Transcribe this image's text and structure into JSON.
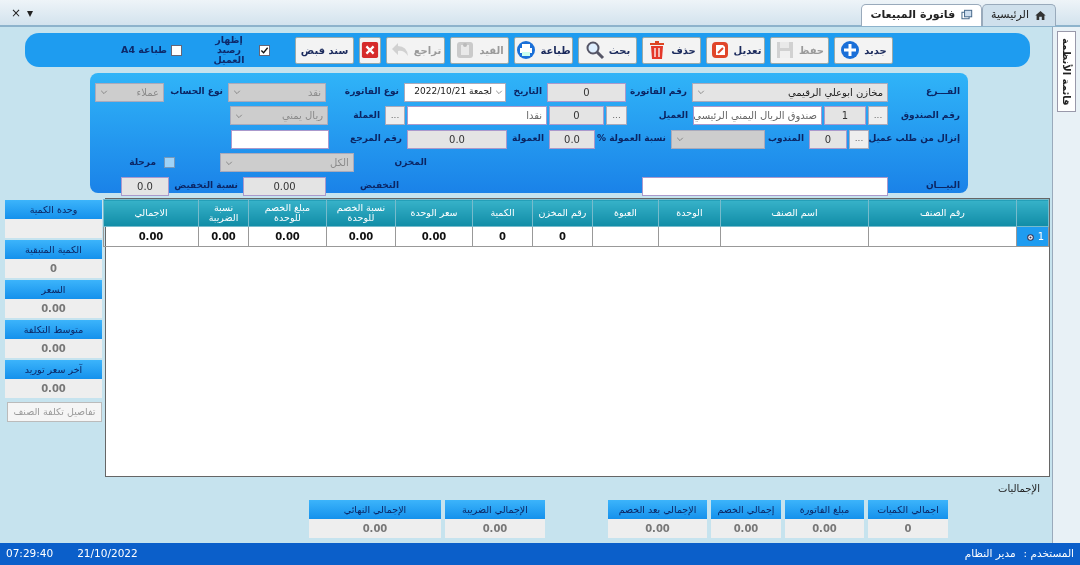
{
  "window_controls": [
    "▾",
    "×"
  ],
  "tabs": [
    {
      "label": "الرئيسية",
      "kind": "home",
      "selected": false
    },
    {
      "label": "فاتورة المبيعات",
      "kind": "window",
      "selected": true
    }
  ],
  "side_tab": {
    "label": "قائمة الأنظمة"
  },
  "toolbar": [
    {
      "kind": "new",
      "label": "جديد",
      "disabled": false
    },
    {
      "kind": "save",
      "label": "حفظ",
      "disabled": true
    },
    {
      "kind": "edit",
      "label": "تعديل",
      "disabled": false
    },
    {
      "kind": "delete",
      "label": "حذف",
      "disabled": false
    },
    {
      "kind": "search",
      "label": "بحث",
      "disabled": false
    },
    {
      "kind": "print",
      "label": "طباعة",
      "disabled": false
    },
    {
      "kind": "post",
      "label": "القيد",
      "disabled": true
    },
    {
      "kind": "undo",
      "label": "تراجع",
      "disabled": true
    },
    {
      "kind": "cancel",
      "disabled": false
    },
    {
      "kind": "text",
      "label": "سند قبض",
      "disabled": false
    },
    {
      "kind": "checkbox",
      "label": "إظهار رصيد العميل",
      "checked": true
    },
    {
      "kind": "checkbox",
      "label": "طباعة A4",
      "checked": false
    }
  ],
  "form": {
    "fields": [
      {
        "label": "الفـــرع",
        "controls": [
          {
            "kind": "select",
            "value": "مخازن ابوعلي الرقيمي",
            "disabled": false
          }
        ]
      },
      {
        "label": "رقم الفاتورة",
        "controls": [
          {
            "kind": "input",
            "value": "0",
            "readonly": true
          }
        ]
      },
      {
        "label": "التاريخ",
        "controls": [
          {
            "kind": "date",
            "value": "لجمعة 2022/10/21"
          }
        ]
      },
      {
        "label": "نوع الفاتورة",
        "controls": [
          {
            "kind": "select",
            "value": "نقد",
            "disabled": true
          }
        ]
      },
      {
        "label": "نوع الحساب",
        "controls": [
          {
            "kind": "select",
            "value": "عملاء",
            "disabled": true
          }
        ]
      },
      {
        "label": "رقم الصندوق",
        "controls": [
          {
            "kind": "lookup",
            "text": "..."
          },
          {
            "kind": "input",
            "value": "1",
            "readonly": true
          },
          {
            "kind": "input",
            "value": "صندوق الريال اليمني الرئيسي",
            "readonly": false
          }
        ]
      },
      {
        "label": "العميل",
        "controls": [
          {
            "kind": "lookup",
            "text": "..."
          },
          {
            "kind": "input",
            "value": "0",
            "readonly": true
          },
          {
            "kind": "input",
            "value": "نقدا",
            "readonly": false
          },
          {
            "kind": "lookup",
            "text": "..."
          }
        ]
      },
      {
        "label": "العملة",
        "controls": [
          {
            "kind": "select",
            "value": "ريال يمني",
            "disabled": true
          }
        ]
      },
      {
        "label": "إنزال من طلب عميل",
        "controls": [
          {
            "kind": "lookup",
            "text": "..."
          },
          {
            "kind": "input",
            "value": "0",
            "readonly": true
          }
        ]
      },
      {
        "label": "المندوب",
        "controls": [
          {
            "kind": "select",
            "disabled": true
          }
        ]
      },
      {
        "label": "نسبة العمولة %",
        "controls": [
          {
            "kind": "input",
            "value": "0.0",
            "readonly": true
          }
        ]
      },
      {
        "label": "العمولة",
        "controls": [
          {
            "kind": "input",
            "value": "0.0",
            "readonly": true
          }
        ]
      },
      {
        "label": "رقم المرجع",
        "controls": [
          {
            "kind": "input",
            "readonly": false
          }
        ]
      },
      {
        "label": "المخزن",
        "controls": [
          {
            "kind": "select",
            "value": "الكل",
            "disabled": true
          }
        ]
      },
      {
        "controls": [
          {
            "kind": "checkbox",
            "label": "مرحلة",
            "checked": false
          }
        ]
      },
      {
        "label": "البيـــان",
        "controls": [
          {
            "kind": "input",
            "readonly": false
          }
        ]
      },
      {
        "label": "التخفيض",
        "controls": [
          {
            "kind": "input",
            "value": "0.00",
            "readonly": true
          }
        ]
      },
      {
        "label": "نسبة التخفيض",
        "controls": [
          {
            "kind": "input",
            "value": "0.0",
            "readonly": true
          }
        ]
      }
    ]
  },
  "grid": {
    "columns": [
      "رقم الصنف",
      "اسم الصنف",
      "الوحدة",
      "العبوة",
      "رقم المخزن",
      "الكمية",
      "سعر الوحدة",
      "نسبة الخصم للوحدة",
      "مبلغ الخصم للوحدة",
      "نسبة الضريبة",
      "الاجمالي"
    ],
    "rows": [
      {
        "number": "1",
        "cells": [
          null,
          null,
          null,
          null,
          "0",
          "0",
          "0.00",
          "0.00",
          "0.00",
          "0.00",
          "0.00"
        ]
      }
    ]
  },
  "item_info": {
    "fields": [
      {
        "label": "وحدة الكمية"
      },
      {
        "label": "الكمية المتبقية",
        "value": "0"
      },
      {
        "label": "السعر",
        "value": "0.00"
      },
      {
        "label": "متوسط التكلفة",
        "value": "0.00"
      },
      {
        "label": "آخر سعر توريد",
        "value": "0.00"
      }
    ],
    "button": {
      "label": "تفاصيل تكلفة الصنف",
      "disabled": true
    }
  },
  "totals": {
    "title": "الإجماليات",
    "items": [
      {
        "label": "اجمالي الكميات",
        "value": "0"
      },
      {
        "label": "مبلغ الفاتورة",
        "value": "0.00"
      },
      {
        "label": "إجمالي الخصم",
        "value": "0.00"
      },
      {
        "label": "الإجمالي بعد الخصم",
        "value": "0.00"
      },
      {
        "label": "الإجمالي الضريبة",
        "value": "0.00"
      },
      {
        "label": "الإجمالي النهائي",
        "value": "0.00"
      }
    ]
  },
  "status_bar": {
    "time": "07:29:40",
    "date": "21/10/2022",
    "user_label": "المستخدم :",
    "user": "مدير النظام"
  }
}
